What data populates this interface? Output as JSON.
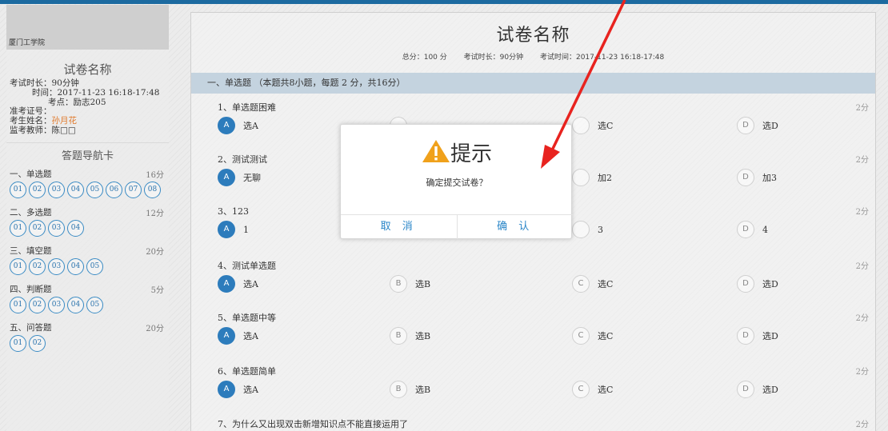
{
  "sidebar": {
    "school": "厦门工学院",
    "title": "试卷名称",
    "info": {
      "duration": "考试时长：90分钟",
      "time": "时间：2017-11-23 16:18-17:48",
      "location": "考点：励志205",
      "ticket": "准考证号：",
      "name_label": "考生姓名：",
      "name_value": "孙月花",
      "teacher": "监考教师：陈□□"
    },
    "nav_title": "答题导航卡",
    "sections": [
      {
        "name": "一、单选题",
        "score": "16分",
        "items": [
          "01",
          "02",
          "03",
          "04",
          "05",
          "06",
          "07",
          "08"
        ]
      },
      {
        "name": "二、多选题",
        "score": "12分",
        "items": [
          "01",
          "02",
          "03",
          "04"
        ]
      },
      {
        "name": "三、填空题",
        "score": "20分",
        "items": [
          "01",
          "02",
          "03",
          "04",
          "05"
        ]
      },
      {
        "name": "四、判断题",
        "score": "5分",
        "items": [
          "01",
          "02",
          "03",
          "04",
          "05"
        ]
      },
      {
        "name": "五、问答题",
        "score": "20分",
        "items": [
          "01",
          "02"
        ]
      }
    ]
  },
  "main": {
    "title": "试卷名称",
    "meta": {
      "total": "总分：100 分",
      "duration": "考试时长：90分钟",
      "time": "考试时间：2017-11-23 16:18-17:48"
    },
    "section_header": "一、单选题 （本题共8小题，每题 2 分，共16分）",
    "questions": [
      {
        "title": "1、单选题困难",
        "score": "2分",
        "options": [
          {
            "letter": "A",
            "text": "选A",
            "selected": true
          },
          {
            "letter": "",
            "text": "",
            "selected": false
          },
          {
            "letter": "",
            "text": "选C",
            "selected": false
          },
          {
            "letter": "D",
            "text": "选D",
            "selected": false
          }
        ]
      },
      {
        "title": "2、测试测试",
        "score": "2分",
        "options": [
          {
            "letter": "A",
            "text": "无聊",
            "selected": true
          },
          {
            "letter": "",
            "text": "",
            "selected": false
          },
          {
            "letter": "",
            "text": "加2",
            "selected": false
          },
          {
            "letter": "D",
            "text": "加3",
            "selected": false
          }
        ]
      },
      {
        "title": "3、123",
        "score": "2分",
        "options": [
          {
            "letter": "A",
            "text": "1",
            "selected": true
          },
          {
            "letter": "",
            "text": "",
            "selected": false
          },
          {
            "letter": "",
            "text": "3",
            "selected": false
          },
          {
            "letter": "D",
            "text": "4",
            "selected": false
          }
        ]
      },
      {
        "title": "4、测试单选题",
        "score": "2分",
        "options": [
          {
            "letter": "A",
            "text": "选A",
            "selected": true
          },
          {
            "letter": "B",
            "text": "选B",
            "selected": false
          },
          {
            "letter": "C",
            "text": "选C",
            "selected": false
          },
          {
            "letter": "D",
            "text": "选D",
            "selected": false
          }
        ]
      },
      {
        "title": "5、单选题中等",
        "score": "2分",
        "options": [
          {
            "letter": "A",
            "text": "选A",
            "selected": true
          },
          {
            "letter": "B",
            "text": "选B",
            "selected": false
          },
          {
            "letter": "C",
            "text": "选C",
            "selected": false
          },
          {
            "letter": "D",
            "text": "选D",
            "selected": false
          }
        ]
      },
      {
        "title": "6、单选题简单",
        "score": "2分",
        "options": [
          {
            "letter": "A",
            "text": "选A",
            "selected": true
          },
          {
            "letter": "B",
            "text": "选B",
            "selected": false
          },
          {
            "letter": "C",
            "text": "选C",
            "selected": false
          },
          {
            "letter": "D",
            "text": "选D",
            "selected": false
          }
        ]
      },
      {
        "title": "7、为什么又出现双击新增知识点不能直接运用了",
        "score": "2分",
        "options": []
      }
    ]
  },
  "modal": {
    "icon": "warning-icon",
    "title": "提示",
    "message": "确定提交试卷？",
    "cancel_label": "取 消",
    "confirm_label": "确 认"
  },
  "colors": {
    "accent": "#2d7cbc",
    "section_bar": "#c4d3df",
    "warning": "#f0a11b",
    "arrow": "#e8231f",
    "student_name": "#e0792b"
  }
}
